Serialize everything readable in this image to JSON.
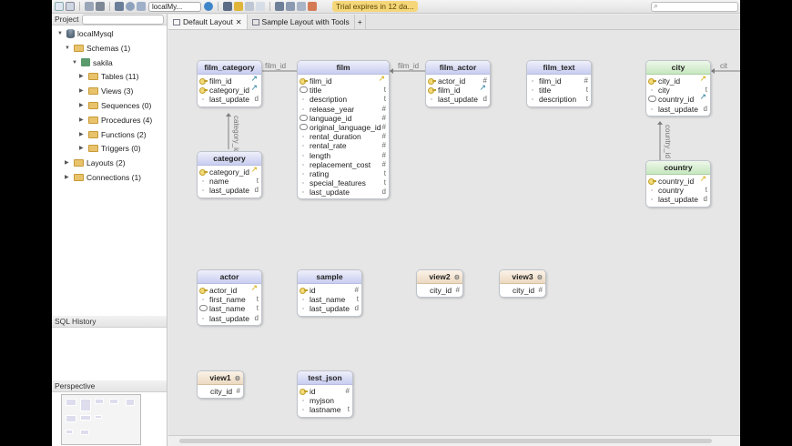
{
  "toolbar": {
    "connection": "localMy...",
    "trial": "Trial expires in 12 da..."
  },
  "left_panel": {
    "project_label": "Project",
    "tree": [
      {
        "label": "localMysql",
        "indent": 0,
        "kind": "db",
        "expanded": true
      },
      {
        "label": "Schemas (1)",
        "indent": 1,
        "kind": "folder",
        "expanded": true
      },
      {
        "label": "sakila",
        "indent": 2,
        "kind": "schema",
        "expanded": true
      },
      {
        "label": "Tables (11)",
        "indent": 3,
        "kind": "folder",
        "expanded": false
      },
      {
        "label": "Views (3)",
        "indent": 3,
        "kind": "folder",
        "expanded": false
      },
      {
        "label": "Sequences (0)",
        "indent": 3,
        "kind": "folder",
        "expanded": false
      },
      {
        "label": "Procedures (4)",
        "indent": 3,
        "kind": "folder",
        "expanded": false
      },
      {
        "label": "Functions (2)",
        "indent": 3,
        "kind": "folder",
        "expanded": false
      },
      {
        "label": "Triggers (0)",
        "indent": 3,
        "kind": "folder",
        "expanded": false
      },
      {
        "label": "Layouts (2)",
        "indent": 1,
        "kind": "folder",
        "expanded": false
      },
      {
        "label": "Connections (1)",
        "indent": 1,
        "kind": "folder",
        "expanded": false
      }
    ],
    "sql_history_label": "SQL History",
    "perspective_label": "Perspective"
  },
  "tabs": [
    {
      "label": "Default Layout",
      "active": true,
      "closable": true
    },
    {
      "label": "Sample Layout with Tools",
      "active": false,
      "closable": false
    }
  ],
  "add_tab": "+",
  "diagram": {
    "tables": [
      {
        "name": "film_category",
        "color": "blue",
        "columns": [
          {
            "name": "film_id",
            "icon": "key",
            "type": "",
            "link": "teal"
          },
          {
            "name": "category_id",
            "icon": "key",
            "type": "",
            "link": "teal"
          },
          {
            "name": "last_update",
            "icon": "dot",
            "type": "d"
          }
        ]
      },
      {
        "name": "film",
        "color": "blue",
        "columns": [
          {
            "name": "film_id",
            "icon": "key",
            "type": "",
            "link": "yellow"
          },
          {
            "name": "title",
            "icon": "fk",
            "type": "t"
          },
          {
            "name": "description",
            "icon": "dot",
            "type": "t"
          },
          {
            "name": "release_year",
            "icon": "dot",
            "type": "#"
          },
          {
            "name": "language_id",
            "icon": "fk",
            "type": "#"
          },
          {
            "name": "original_language_id",
            "icon": "fk",
            "type": "#"
          },
          {
            "name": "rental_duration",
            "icon": "dot",
            "type": "#"
          },
          {
            "name": "rental_rate",
            "icon": "dot",
            "type": "#"
          },
          {
            "name": "length",
            "icon": "dot",
            "type": "#"
          },
          {
            "name": "replacement_cost",
            "icon": "dot",
            "type": "#"
          },
          {
            "name": "rating",
            "icon": "dot",
            "type": "t"
          },
          {
            "name": "special_features",
            "icon": "dot",
            "type": "t"
          },
          {
            "name": "last_update",
            "icon": "dot",
            "type": "d"
          }
        ]
      },
      {
        "name": "film_actor",
        "color": "blue",
        "columns": [
          {
            "name": "actor_id",
            "icon": "key",
            "type": "#"
          },
          {
            "name": "film_id",
            "icon": "key",
            "type": "",
            "link": "teal"
          },
          {
            "name": "last_update",
            "icon": "dot",
            "type": "d"
          }
        ]
      },
      {
        "name": "film_text",
        "color": "blue",
        "columns": [
          {
            "name": "film_id",
            "icon": "dot",
            "type": "#"
          },
          {
            "name": "title",
            "icon": "dot",
            "type": "t"
          },
          {
            "name": "description",
            "icon": "dot",
            "type": "t"
          }
        ]
      },
      {
        "name": "city",
        "color": "green",
        "columns": [
          {
            "name": "city_id",
            "icon": "key",
            "type": "",
            "link": "yellow"
          },
          {
            "name": "city",
            "icon": "dot",
            "type": "t"
          },
          {
            "name": "country_id",
            "icon": "fk",
            "type": "",
            "link": "teal"
          },
          {
            "name": "last_update",
            "icon": "dot",
            "type": "d"
          }
        ]
      },
      {
        "name": "category",
        "color": "blue",
        "columns": [
          {
            "name": "category_id",
            "icon": "key",
            "type": "",
            "link": "yellow"
          },
          {
            "name": "name",
            "icon": "dot",
            "type": "t"
          },
          {
            "name": "last_update",
            "icon": "dot",
            "type": "d"
          }
        ]
      },
      {
        "name": "country",
        "color": "green",
        "columns": [
          {
            "name": "country_id",
            "icon": "key",
            "type": "",
            "link": "yellow"
          },
          {
            "name": "country",
            "icon": "dot",
            "type": "t"
          },
          {
            "name": "last_update",
            "icon": "dot",
            "type": "d"
          }
        ]
      },
      {
        "name": "actor",
        "color": "blue",
        "columns": [
          {
            "name": "actor_id",
            "icon": "key",
            "type": "",
            "link": "yellow"
          },
          {
            "name": "first_name",
            "icon": "dot",
            "type": "t"
          },
          {
            "name": "last_name",
            "icon": "fk",
            "type": "t"
          },
          {
            "name": "last_update",
            "icon": "dot",
            "type": "d"
          }
        ]
      },
      {
        "name": "sample",
        "color": "blue",
        "columns": [
          {
            "name": "id",
            "icon": "key",
            "type": "#"
          },
          {
            "name": "last_name",
            "icon": "dot",
            "type": "t"
          },
          {
            "name": "last_update",
            "icon": "dot",
            "type": "d"
          }
        ]
      },
      {
        "name": "view2",
        "color": "view",
        "columns": [
          {
            "name": "city_id",
            "icon": "none",
            "type": "#"
          }
        ]
      },
      {
        "name": "view3",
        "color": "view",
        "columns": [
          {
            "name": "city_id",
            "icon": "none",
            "type": "#"
          }
        ]
      },
      {
        "name": "view1",
        "color": "view",
        "columns": [
          {
            "name": "city_id",
            "icon": "none",
            "type": "#"
          }
        ]
      },
      {
        "name": "test_json",
        "color": "blue",
        "columns": [
          {
            "name": "id",
            "icon": "key",
            "type": "#"
          },
          {
            "name": "myjson",
            "icon": "dot",
            "type": ""
          },
          {
            "name": "lastname",
            "icon": "dot",
            "type": "t"
          }
        ]
      }
    ],
    "edge_labels": [
      "film_id",
      "film_id",
      "category_id",
      "country_id",
      "cit"
    ]
  }
}
